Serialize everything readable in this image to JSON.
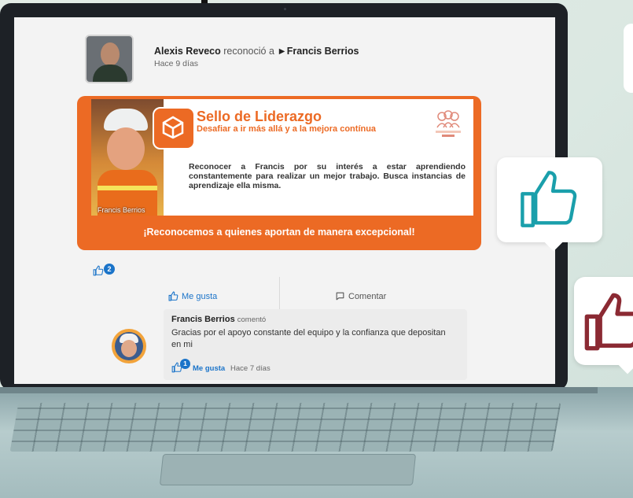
{
  "post": {
    "author": "Alexis Reveco",
    "action": "reconoció a",
    "recipient_marker": "►",
    "recipient": "Francis Berrios",
    "time": "Hace 9 días"
  },
  "banner": {
    "title": "Sello de Liderazgo",
    "subtitle": "Desafiar a ir más allá y a la mejora contínua",
    "photo_caption": "Francis Berrios",
    "message": "Reconocer a Francis por su interés a estar aprendiendo constantemente para realizar un mejor trabajo. Busca instancias de aprendizaje ella misma.",
    "footer": "¡Reconocemos a quienes aportan de manera excepcional!",
    "accent_color": "#ec6a24"
  },
  "reactions": {
    "like_count": "2",
    "like_label": "Me gusta",
    "comment_label": "Comentar",
    "link_color": "#1b74c9"
  },
  "comment": {
    "author": "Francis Berrios",
    "verb": "comentó",
    "text": "Gracias por el apoyo constante del equipo y la confianza que depositan en mi",
    "like_count": "1",
    "like_label": "Me gusta",
    "time": "Hace 7 días"
  },
  "decor": {
    "bubble_teal_icon": "thumbs-up-icon",
    "bubble_teal_color": "#1a9fab",
    "bubble_maroon_icon": "thumbs-up-icon",
    "bubble_maroon_color": "#8b2a33"
  }
}
